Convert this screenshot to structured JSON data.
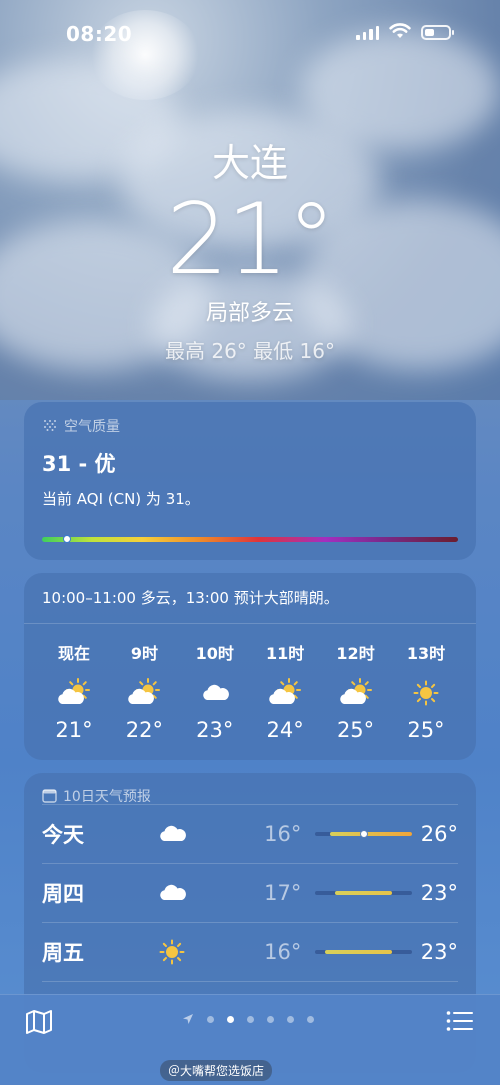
{
  "status_bar": {
    "time": "08:20",
    "battery_percent": 40
  },
  "location": {
    "city": "大连",
    "temperature": "21°",
    "condition": "局部多云",
    "high_low": "最高 26°  最低 16°"
  },
  "air_quality": {
    "header": "空气质量",
    "value": "31 - 优",
    "description": "当前 AQI (CN) 为 31。",
    "indicator_fraction": 0.06
  },
  "hourly": {
    "summary": "10:00–11:00 多云，13:00 预计大部晴朗。",
    "items": [
      {
        "label": "现在",
        "icon": "partly-sunny-icon",
        "temp": "21°"
      },
      {
        "label": "9时",
        "icon": "partly-sunny-icon",
        "temp": "22°"
      },
      {
        "label": "10时",
        "icon": "cloud-icon",
        "temp": "23°"
      },
      {
        "label": "11时",
        "icon": "partly-sunny-icon",
        "temp": "24°"
      },
      {
        "label": "12时",
        "icon": "partly-sunny-icon",
        "temp": "25°"
      },
      {
        "label": "13时",
        "icon": "sun-icon",
        "temp": "25°"
      }
    ]
  },
  "daily": {
    "header": "10日天气预报",
    "rows": [
      {
        "day": "今天",
        "icon": "cloud-icon",
        "low": "16°",
        "high": "26°",
        "range_start": 0.15,
        "range_end": 1.0,
        "current": 0.5,
        "colors": [
          "#d8d05a",
          "#f0a53a"
        ]
      },
      {
        "day": "周四",
        "icon": "cloud-icon",
        "low": "17°",
        "high": "23°",
        "range_start": 0.2,
        "range_end": 0.8,
        "current": null,
        "colors": [
          "#d8d05a",
          "#e6c34a"
        ]
      },
      {
        "day": "周五",
        "icon": "sun-icon",
        "low": "16°",
        "high": "23°",
        "range_start": 0.1,
        "range_end": 0.8,
        "current": null,
        "colors": [
          "#d8d05a",
          "#e6c34a"
        ]
      }
    ]
  },
  "page_dots": {
    "count": 6,
    "active_index": 1
  },
  "watermark": "＠大嘴帮您选饭店",
  "colors": {
    "accent": "#4f82c8",
    "sun": "#f5c542"
  }
}
